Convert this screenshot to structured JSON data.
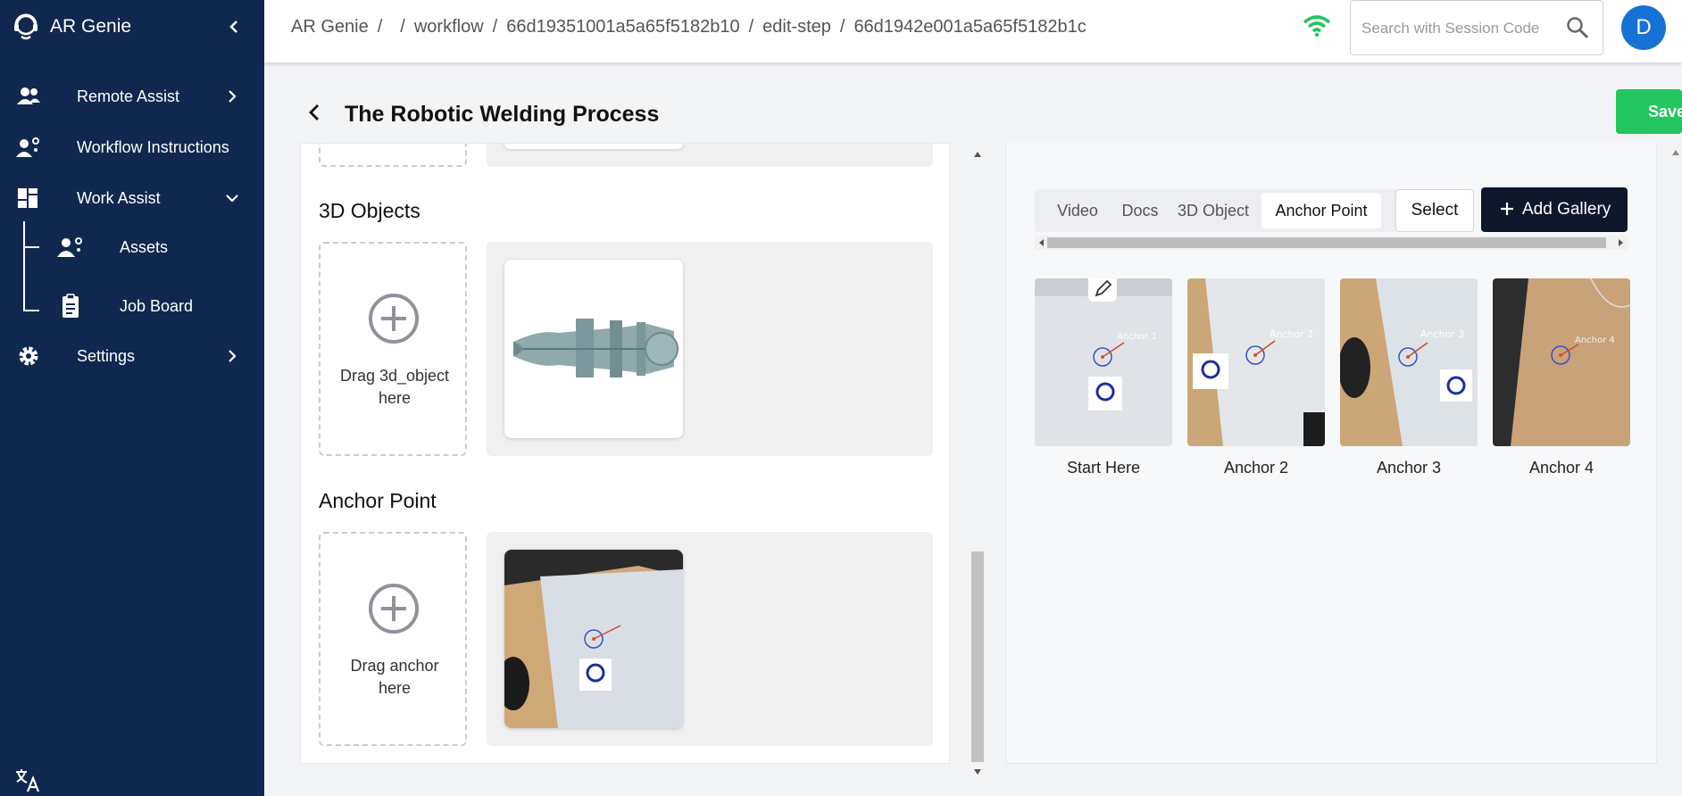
{
  "app": {
    "name": "AR Genie"
  },
  "sidebar": {
    "items": [
      {
        "label": "Remote Assist",
        "icon": "people-icon"
      },
      {
        "label": "Workflow Instructions",
        "icon": "workflow-people-icon"
      },
      {
        "label": "Work Assist",
        "icon": "dashboard-icon"
      },
      {
        "label": "Settings",
        "icon": "gear-icon"
      }
    ],
    "sub_items": [
      {
        "label": "Assets",
        "icon": "assets-icon"
      },
      {
        "label": "Job Board",
        "icon": "clipboard-icon"
      }
    ]
  },
  "breadcrumb": [
    "AR Genie",
    "/",
    "",
    "/",
    "workflow",
    "/",
    "66d19351001a5a65f5182b10",
    "/",
    "edit-step",
    "/",
    "66d1942e001a5a65f5182b1c"
  ],
  "search": {
    "placeholder": "Search with Session Code"
  },
  "user": {
    "initial": "D"
  },
  "page": {
    "title": "The Robotic Welding Process",
    "save_label": "Save"
  },
  "sections": {
    "objects": {
      "title": "3D Objects",
      "drop_label": "Drag 3d_object here"
    },
    "anchor": {
      "title": "Anchor Point",
      "drop_label": "Drag anchor here"
    }
  },
  "gallery": {
    "tabs": [
      "Video",
      "Docs",
      "3D Object",
      "Anchor Point"
    ],
    "active_tab": "Anchor Point",
    "select_label": "Select",
    "add_label": "Add Gallery",
    "items": [
      {
        "caption": "Start Here",
        "overlay": "Anchor 1"
      },
      {
        "caption": "Anchor 2",
        "overlay": "Anchor 2"
      },
      {
        "caption": "Anchor 3",
        "overlay": "Anchor 3"
      },
      {
        "caption": "Anchor 4",
        "overlay": "Anchor 4"
      }
    ]
  },
  "colors": {
    "sidebar": "#10284f",
    "save": "#22c55e",
    "avatar": "#1672d4",
    "wifi": "#22c55e",
    "add_gallery": "#0f172a"
  }
}
